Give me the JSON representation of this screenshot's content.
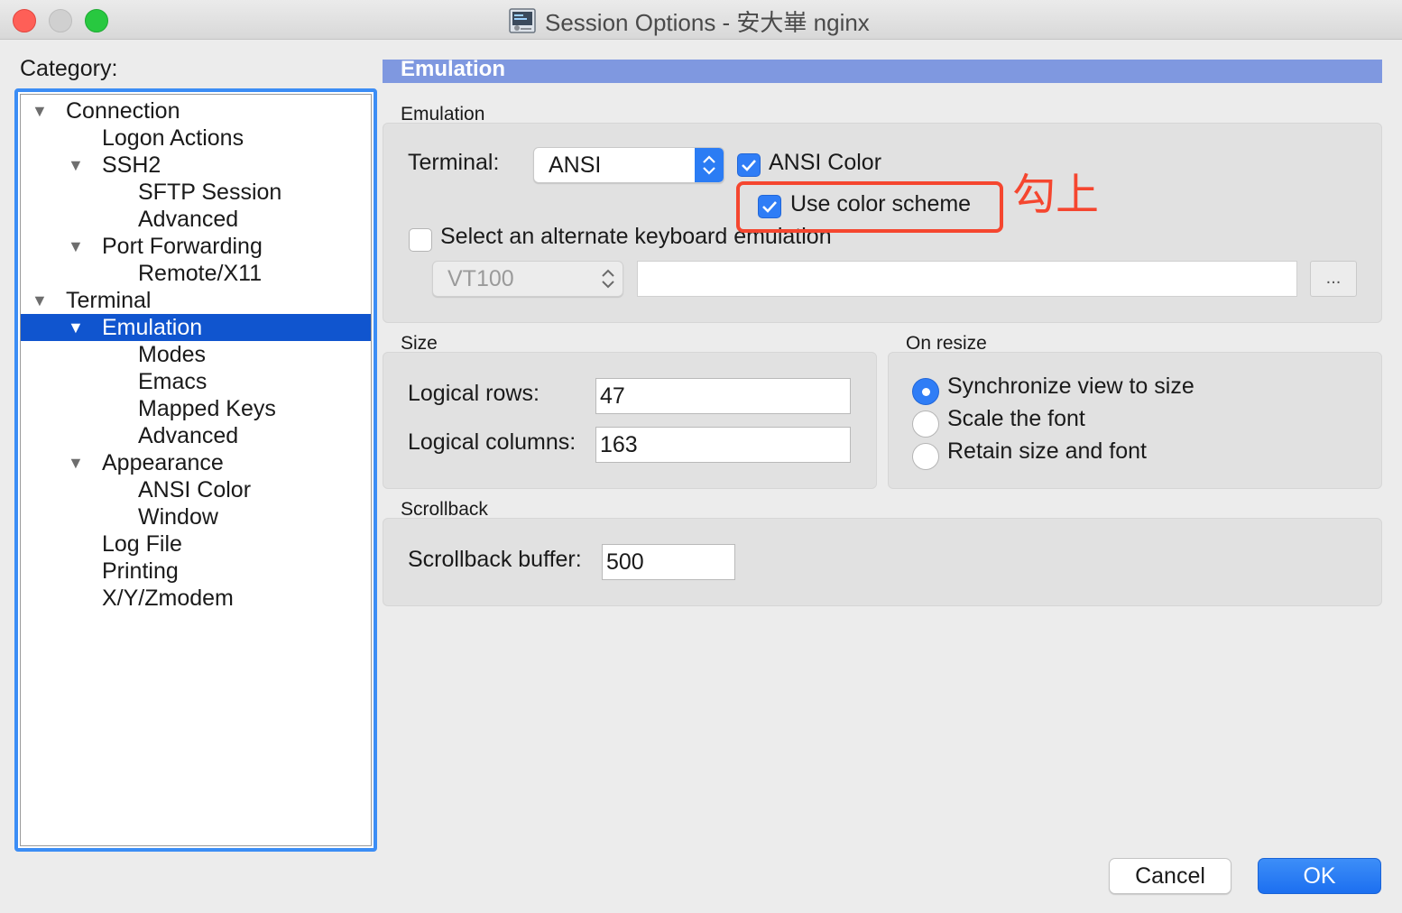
{
  "window": {
    "title": "Session Options - 安大崋 nginx"
  },
  "sidebar": {
    "label": "Category:",
    "items": [
      {
        "label": "Connection"
      },
      {
        "label": "Logon Actions"
      },
      {
        "label": "SSH2"
      },
      {
        "label": "SFTP Session"
      },
      {
        "label": "Advanced"
      },
      {
        "label": "Port Forwarding"
      },
      {
        "label": "Remote/X11"
      },
      {
        "label": "Terminal"
      },
      {
        "label": "Emulation"
      },
      {
        "label": "Modes"
      },
      {
        "label": "Emacs"
      },
      {
        "label": "Mapped Keys"
      },
      {
        "label": "Advanced"
      },
      {
        "label": "Appearance"
      },
      {
        "label": "ANSI Color"
      },
      {
        "label": "Window"
      },
      {
        "label": "Log File"
      },
      {
        "label": "Printing"
      },
      {
        "label": "X/Y/Zmodem"
      }
    ],
    "selected": "Emulation"
  },
  "panel": {
    "header": "Emulation",
    "emulation": {
      "group_title": "Emulation",
      "terminal_label": "Terminal:",
      "terminal_value": "ANSI",
      "ansi_color_label": "ANSI Color",
      "ansi_color_checked": true,
      "use_color_scheme_label": "Use color scheme",
      "use_color_scheme_checked": true,
      "alt_keyboard_label": "Select an alternate keyboard emulation",
      "alt_keyboard_checked": false,
      "alt_keyboard_value": "VT100",
      "alt_keyboard_path": "",
      "browse_label": "..."
    },
    "size": {
      "group_title": "Size",
      "rows_label": "Logical rows:",
      "rows_value": "47",
      "columns_label": "Logical columns:",
      "columns_value": "163"
    },
    "on_resize": {
      "group_title": "On resize",
      "options": [
        {
          "label": "Synchronize view to size",
          "checked": true
        },
        {
          "label": "Scale the font",
          "checked": false
        },
        {
          "label": "Retain size and font",
          "checked": false
        }
      ]
    },
    "scrollback": {
      "group_title": "Scrollback",
      "buffer_label": "Scrollback buffer:",
      "buffer_value": "500"
    }
  },
  "annotation": {
    "text": "勾上",
    "color": "#f5462f"
  },
  "buttons": {
    "cancel": "Cancel",
    "ok": "OK"
  },
  "colors": {
    "accent": "#2f7df6",
    "selection": "#1055cf",
    "header": "#7f98e0"
  }
}
